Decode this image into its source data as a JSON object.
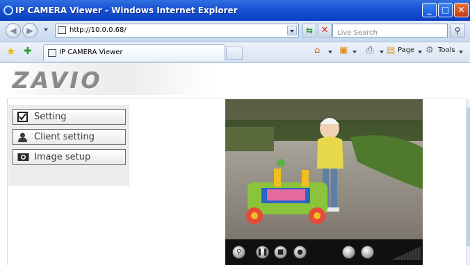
{
  "window": {
    "title": "IP CAMERA Viewer - Windows Internet Explorer"
  },
  "addressbar": {
    "url": "http://10.0.0.68/",
    "search_placeholder": "Live Search"
  },
  "tab": {
    "label": "IP CAMERA Viewer"
  },
  "commandbar": {
    "page_label": "Page",
    "tools_label": "Tools"
  },
  "page": {
    "logo_text": "ZAVIO",
    "menu": [
      {
        "label": "Setting",
        "icon": "checkbox-icon"
      },
      {
        "label": "Client setting",
        "icon": "user-icon"
      },
      {
        "label": "Image setup",
        "icon": "camera-icon"
      }
    ],
    "video_controls": [
      "zoom-icon",
      "pause-icon",
      "stop-icon",
      "record-icon",
      "snapshot-icon",
      "audio-icon"
    ]
  },
  "colors": {
    "titlebar": "#1c55d6",
    "menu_panel": "#ececec",
    "control_bar": "#101010"
  }
}
